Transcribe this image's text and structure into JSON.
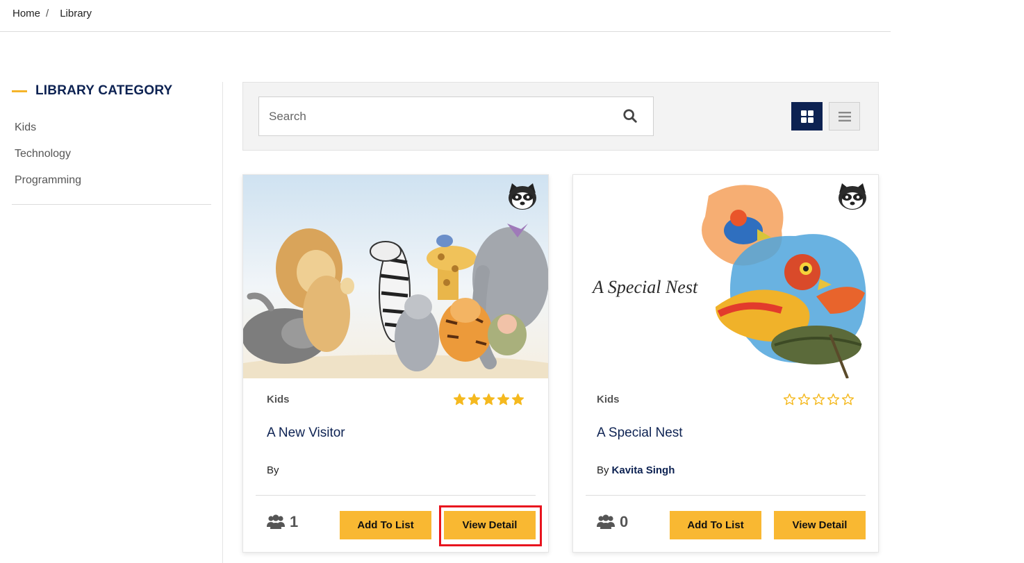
{
  "breadcrumb": {
    "home": "Home",
    "separator": "/",
    "current": "Library"
  },
  "sidebar": {
    "title": "LIBRARY CATEGORY",
    "categories": [
      "Kids",
      "Technology",
      "Programming"
    ]
  },
  "search": {
    "placeholder": "Search",
    "value": ""
  },
  "view_toggle": {
    "active": "grid",
    "icons": [
      "grid-icon",
      "list-icon"
    ]
  },
  "books": [
    {
      "category": "Kids",
      "title": "A New Visitor",
      "by_label": "By",
      "author": "",
      "rating": 5,
      "max_rating": 5,
      "readers": "1",
      "add_label": "Add To List",
      "view_label": "View Detail"
    },
    {
      "category": "Kids",
      "title": "A Special Nest",
      "cover_text": "A Special Nest",
      "by_label": "By",
      "author": "Kavita Singh",
      "rating": 0,
      "max_rating": 5,
      "readers": "0",
      "add_label": "Add To List",
      "view_label": "View Detail"
    }
  ],
  "colors": {
    "accent": "#f9b832",
    "navy": "#0d2252",
    "star": "#f5b91f",
    "highlight": "#e8141e"
  }
}
